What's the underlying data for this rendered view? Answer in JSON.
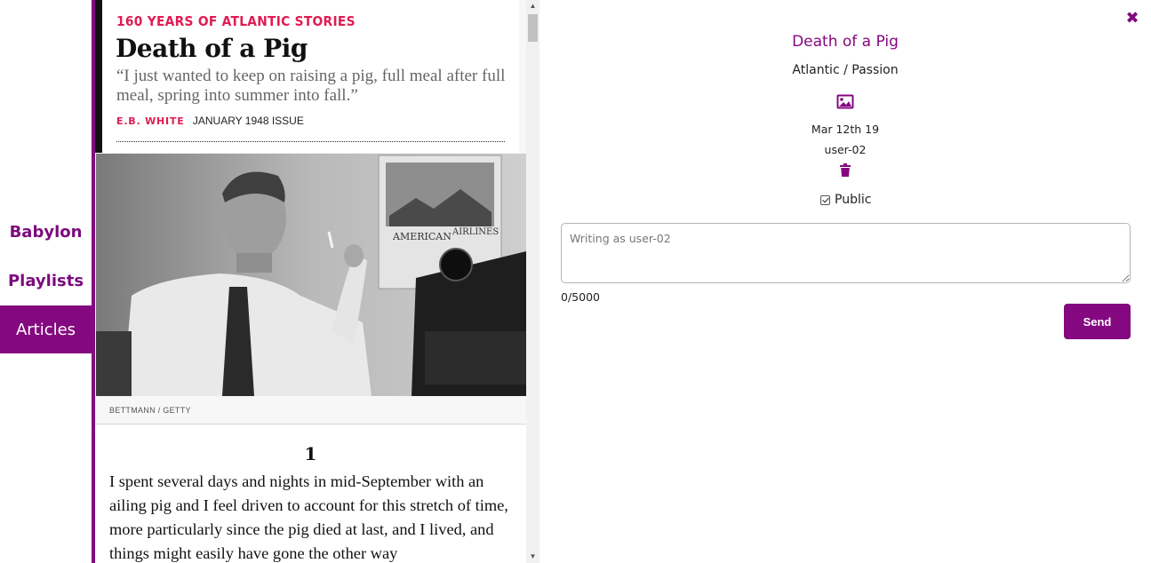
{
  "sidebar": {
    "items": [
      {
        "label": "Babylon",
        "active": false
      },
      {
        "label": "Playlists",
        "active": false
      },
      {
        "label": "Articles",
        "active": true
      }
    ]
  },
  "article": {
    "kicker": "160 YEARS OF ATLANTIC STORIES",
    "title": "Death of a Pig",
    "dek": "“I just wanted to keep on raising a pig, full meal after full meal, spring into summer into fall.”",
    "author": "E.B. WHITE",
    "issue": "JANUARY 1948 ISSUE",
    "photo_credit": "BETTMANN / GETTY",
    "photo_poster_text": [
      "AMERICAN",
      "AIRLINES"
    ],
    "section_number": "1",
    "body": "I spent several days and nights in mid-September with an ailing pig and I feel driven to account for this stretch of time, more particularly since the pig died at last, and I lived, and things might easily have gone the other way"
  },
  "detail": {
    "close_symbol": "✖",
    "title": "Death of a Pig",
    "source": "Atlantic / Passion",
    "date": "Mar 12th 19",
    "user": "user-02",
    "public_label": "Public",
    "public_checked": true,
    "comment_value": "",
    "comment_placeholder": "Writing as user-02",
    "char_count": "0/5000",
    "send_label": "Send"
  },
  "icons": {
    "image": "image-icon",
    "delete": "trash-icon",
    "close": "close-icon"
  },
  "colors": {
    "accent": "#84087f",
    "kicker": "#e01c52"
  }
}
